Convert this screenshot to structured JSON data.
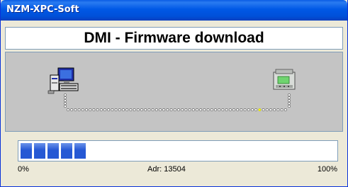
{
  "window": {
    "title": "NZM-XPC-Soft"
  },
  "heading": "DMI - Firmware download",
  "diagram": {
    "source_icon": "pc-computer-icon",
    "target_icon": "plc-device-icon",
    "dot_color": "#555555",
    "active_dot_color": "#ffff00"
  },
  "progress": {
    "value_fraction": 0.2,
    "min_label": "0%",
    "max_label": "100%",
    "address_label": "Adr: 13504",
    "bar_color": "#2558d4"
  }
}
